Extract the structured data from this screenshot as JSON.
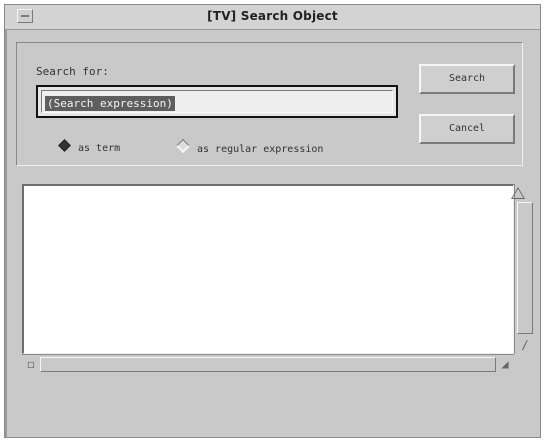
{
  "window": {
    "title": "[TV]  Search Object"
  },
  "search": {
    "label": "Search for:",
    "value": "(Search expression)"
  },
  "buttons": {
    "search_label": "Search",
    "cancel_label": "Cancel"
  },
  "mode": {
    "options": [
      {
        "label": "as term",
        "selected": true
      },
      {
        "label": "as regular expression",
        "selected": false
      }
    ]
  },
  "icons": {
    "window_menu": "window-menu-icon",
    "selected_radio": "diamond-filled-icon",
    "unselected_radio": "diamond-empty-icon",
    "scroll_up": "scroll-up-arrow-icon",
    "scroll_down": "scroll-down-arrow-icon",
    "scroll_left": "scroll-left-arrow-icon",
    "scroll_right": "scroll-right-arrow-icon"
  },
  "colors": {
    "window_bg": "#c9c9c9",
    "results_bg": "#ffffff",
    "selection_bg": "#5e5e5e"
  }
}
